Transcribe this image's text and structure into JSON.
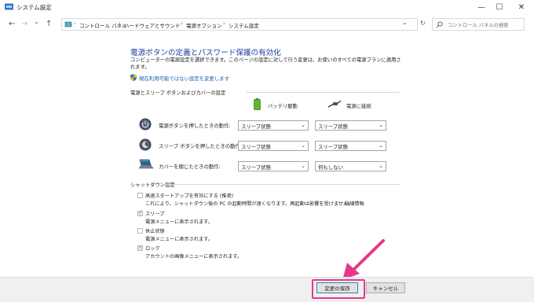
{
  "window": {
    "title": "システム設定",
    "minimize_glyph": "—",
    "maximize_glyph": "☐",
    "close_glyph": "✕"
  },
  "nav": {
    "back": "←",
    "forward": "→",
    "recent": "⌄",
    "up": "↑",
    "breadcrumb": [
      "コントロール パネル",
      "ハードウェアとサウンド",
      "電源オプション",
      "システム設定"
    ],
    "sep": "›",
    "refresh": "↻",
    "search_placeholder": "コントロール パネルの検索"
  },
  "main": {
    "heading": "電源ボタンの定義とパスワード保護の有効化",
    "description": "コンピューターの電源設定を選択できます。このページの設定に対して行う変更は、お使いのすべての電源プランに適用されます。",
    "change_link": "現在利用可能ではない設定を変更します",
    "buttons_section_title": "電源とスリープ ボタンおよびカバーの設定",
    "col_battery": "バッテリ駆動",
    "col_plugged": "電源に接続",
    "rows": [
      {
        "label": "電源ボタンを押したときの動作:",
        "battery": "スリープ状態",
        "plugged": "スリープ状態"
      },
      {
        "label": "スリープ ボタンを押したときの動作:",
        "battery": "スリープ状態",
        "plugged": "スリープ状態"
      },
      {
        "label": "カバーを閉じたときの動作:",
        "battery": "スリープ状態",
        "plugged": "何もしない"
      }
    ],
    "shutdown_title": "シャットダウン設定",
    "fast_startup": {
      "label": "高速スタートアップを有効にする (推奨)",
      "desc": "これにより、シャットダウン後の PC の起動時間が速くなります。再起動は影響を受けません。",
      "link": "詳細情報",
      "checked": false
    },
    "sleep": {
      "label": "スリープ",
      "desc": "電源メニューに表示されます。",
      "checked": true
    },
    "hibernate": {
      "label": "休止状態",
      "desc": "電源メニューに表示されます。",
      "checked": false
    },
    "lock": {
      "label": "ロック",
      "desc": "アカウントの画像メニューに表示されます。",
      "checked": true
    }
  },
  "footer": {
    "save_label": "変更の保存",
    "cancel_label": "キャンセル"
  },
  "colors": {
    "heading": "#1c3f9f",
    "link": "#1a5fb4",
    "highlight": "#e8388a"
  }
}
